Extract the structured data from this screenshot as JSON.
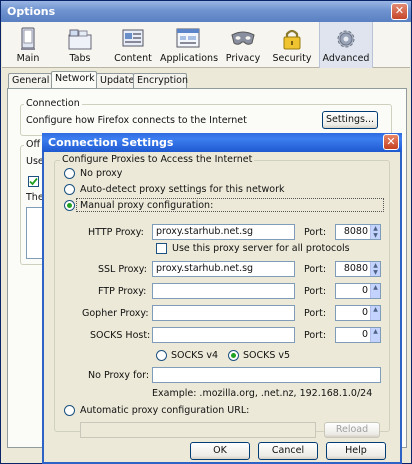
{
  "window": {
    "title": "Options",
    "close_glyph": "✕"
  },
  "toolbar": {
    "items": [
      {
        "label": "Main",
        "icon": "main-icon"
      },
      {
        "label": "Tabs",
        "icon": "tabs-icon"
      },
      {
        "label": "Content",
        "icon": "content-icon"
      },
      {
        "label": "Applications",
        "icon": "applications-icon"
      },
      {
        "label": "Privacy",
        "icon": "privacy-icon"
      },
      {
        "label": "Security",
        "icon": "security-icon"
      },
      {
        "label": "Advanced",
        "icon": "advanced-icon",
        "selected": true
      }
    ]
  },
  "subtabs": [
    {
      "label": "General"
    },
    {
      "label": "Network",
      "selected": true
    },
    {
      "label": "Update"
    },
    {
      "label": "Encryption"
    }
  ],
  "network": {
    "connection_group": "Connection",
    "connection_text": "Configure how Firefox connects to the Internet",
    "settings_button": "Settings...",
    "offline_group_partial": "Off",
    "use_partial": "Use",
    "the_partial": "The"
  },
  "dialog": {
    "title": "Connection Settings",
    "close_glyph": "✕",
    "group_label": "Configure Proxies to Access the Internet",
    "no_proxy": "No proxy",
    "auto_detect": "Auto-detect proxy settings for this network",
    "manual": "Manual proxy configuration:",
    "selected_mode": "manual",
    "http_label": "HTTP Proxy:",
    "http_value": "proxy.starhub.net.sg",
    "http_port": "8080",
    "use_for_all": "Use this proxy server for all protocols",
    "use_for_all_checked": false,
    "ssl_label": "SSL Proxy:",
    "ssl_value": "proxy.starhub.net.sg",
    "ssl_port": "8080",
    "ftp_label": "FTP Proxy:",
    "ftp_value": "",
    "ftp_port": "0",
    "gopher_label": "Gopher Proxy:",
    "gopher_value": "",
    "gopher_port": "0",
    "socks_label": "SOCKS Host:",
    "socks_value": "",
    "socks_port": "0",
    "port_label": "Port:",
    "socks_v4": "SOCKS v4",
    "socks_v5": "SOCKS v5",
    "socks_version": "v5",
    "no_proxy_for_label": "No Proxy for:",
    "no_proxy_for_value": "",
    "example": "Example: .mozilla.org, .net.nz, 192.168.1.0/24",
    "auto_config_label": "Automatic proxy configuration URL:",
    "auto_config_value": "",
    "reload_button": "Reload",
    "ok_button": "OK",
    "cancel_button": "Cancel",
    "help_button": "Help"
  }
}
